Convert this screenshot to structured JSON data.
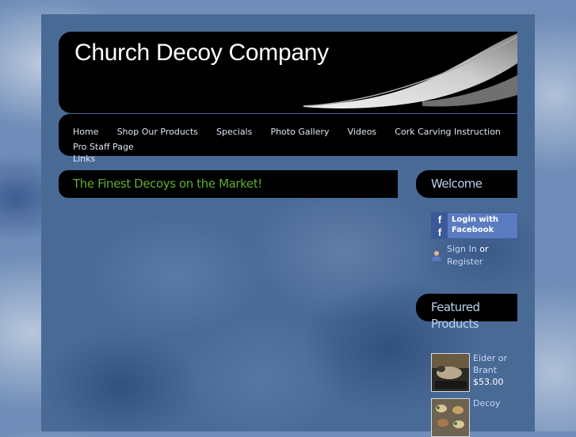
{
  "site": {
    "title": "Church Decoy Company"
  },
  "nav": {
    "items": [
      "Home",
      "Shop Our Products",
      "Specials",
      "Photo Gallery",
      "Videos",
      "Cork Carving Instruction",
      "Pro Staff Page",
      "Links"
    ]
  },
  "main": {
    "heading": "The Finest Decoys on the Market!"
  },
  "sidebar": {
    "welcome_heading": "Welcome",
    "facebook_button": {
      "line1": "Login with",
      "line2": "Facebook",
      "icon_letter": "f"
    },
    "sign_in": "Sign In",
    "or_text": "or",
    "register": "Register",
    "featured_line1": "Featured",
    "featured_line2": "Products",
    "products": [
      {
        "name": "Eider or Brant",
        "price": "$53.00"
      },
      {
        "name": "Decoy",
        "price": ""
      }
    ]
  },
  "colors": {
    "heading_green": "#5fae2f",
    "sidebar_heading": "#b9d2f0",
    "link": "#c3d7f5",
    "facebook_blue": "#3b5998"
  },
  "icons": [
    "feather-image",
    "facebook-icon",
    "user-icon"
  ]
}
